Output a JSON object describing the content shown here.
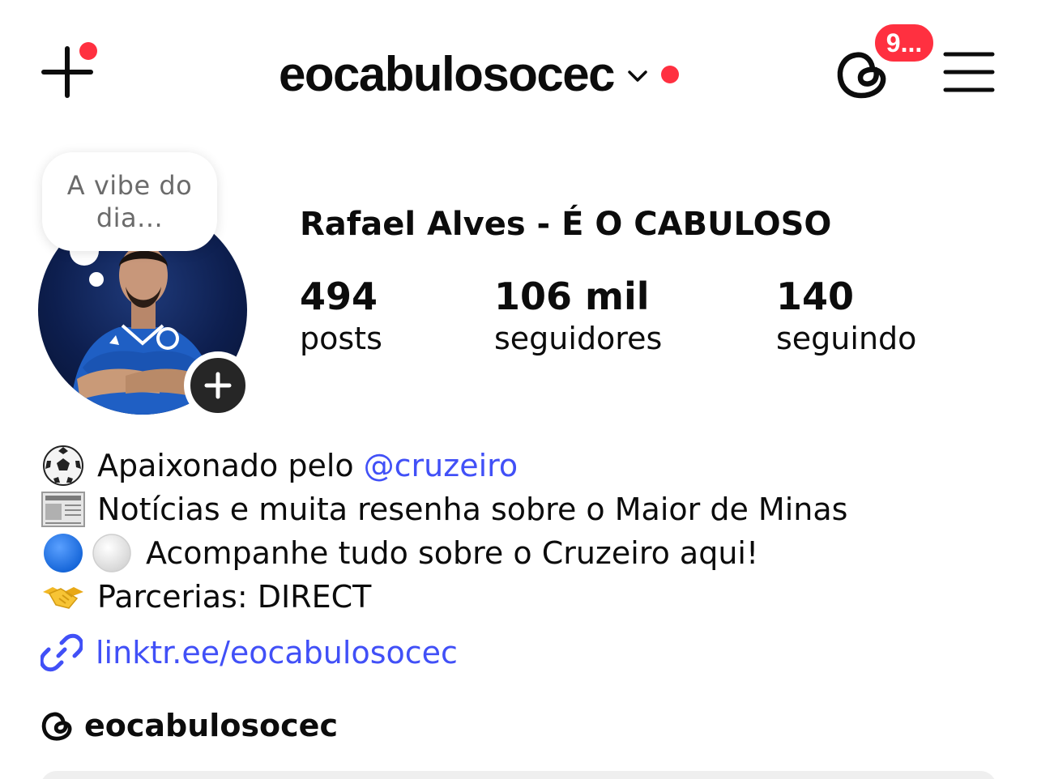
{
  "header": {
    "username": "eocabulosocec",
    "threads_badge": "9..."
  },
  "profile": {
    "note": "A vibe do dia...",
    "full_name": "Rafael Alves - É O CABULOSO",
    "stats": [
      {
        "value": "494",
        "label": "posts"
      },
      {
        "value": "106 mil",
        "label": "seguidores"
      },
      {
        "value": "140",
        "label": "seguindo"
      }
    ]
  },
  "bio": {
    "line1_text": "Apaixonado pelo ",
    "line1_mention": "@cruzeiro",
    "line2_text": "Notícias e muita resenha sobre o Maior de Minas",
    "line3_text": "Acompanhe tudo sobre o Cruzeiro aqui!",
    "line4_text": "Parcerias: DIRECT",
    "link": "linktr.ee/eocabulosocec",
    "threads_handle": "eocabulosocec"
  },
  "icons": {
    "line1": "soccer-ball-icon",
    "line2": "newspaper-icon",
    "line3": [
      "blue-circle-icon",
      "white-circle-icon"
    ],
    "line4": "handshake-icon",
    "link": "link-icon",
    "threads": "threads-icon"
  },
  "colors": {
    "notification_red": "#ff3040",
    "link_blue": "#4150f7",
    "text": "#0c0c0c"
  }
}
